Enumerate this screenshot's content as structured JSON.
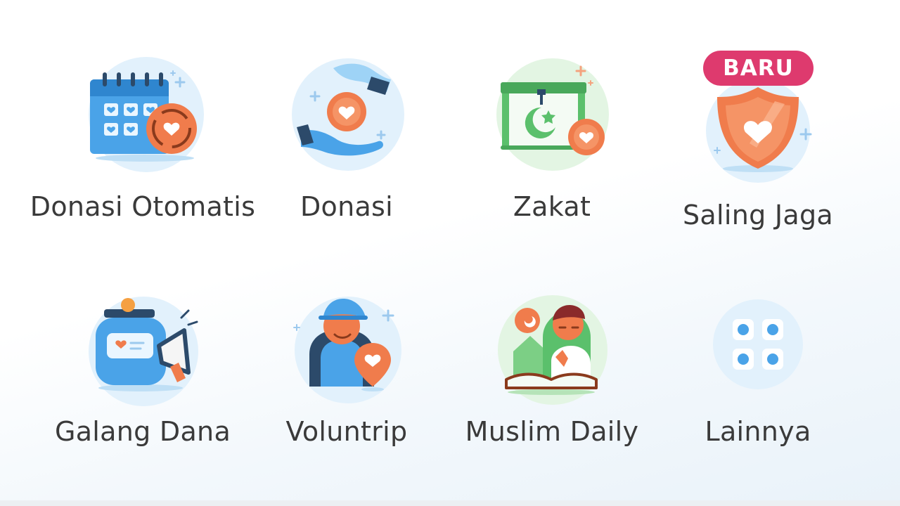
{
  "menu": {
    "items": [
      {
        "label": "Donasi Otomatis",
        "icon": "calendar-recurring-icon"
      },
      {
        "label": "Donasi",
        "icon": "donation-hands-icon"
      },
      {
        "label": "Zakat",
        "icon": "zakat-frame-icon"
      },
      {
        "label": "Saling Jaga",
        "icon": "shield-heart-icon",
        "badge": "BARU"
      },
      {
        "label": "Galang Dana",
        "icon": "jar-megaphone-icon"
      },
      {
        "label": "Voluntrip",
        "icon": "volunteer-icon"
      },
      {
        "label": "Muslim Daily",
        "icon": "muslim-prayer-icon"
      },
      {
        "label": "Lainnya",
        "icon": "more-grid-icon"
      }
    ]
  },
  "colors": {
    "text": "#3a3a3a",
    "badge": "#de3a6e",
    "orange": "#f07c4c",
    "blue": "#4aa3e8",
    "green": "#5bc06c",
    "icon_bg_blue": "#e2f1fc",
    "icon_bg_green": "#e3f5e3"
  }
}
